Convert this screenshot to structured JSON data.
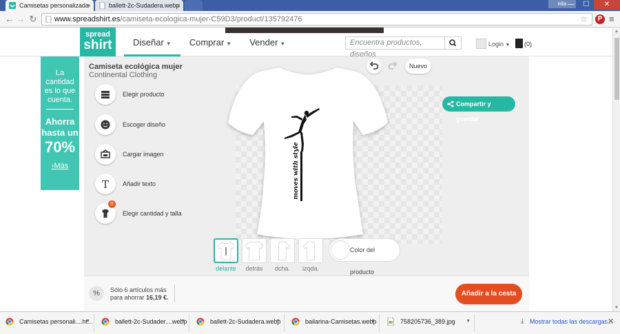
{
  "browser": {
    "tabs": [
      {
        "title": "Camisetas personalizada"
      },
      {
        "title": "ballett-2c-Sudadera.webp"
      }
    ],
    "user": "elia",
    "url_host": "www.spreadshirt.es",
    "url_path": "/camiseta-ecologica-mujer-C59D3/product/135792476",
    "window_controls": {
      "minimize": "—",
      "maximize": "☐",
      "close": "✕"
    }
  },
  "site": {
    "logo_line1": "spread",
    "logo_line2": "shirt",
    "promo_strip": "",
    "nav": [
      {
        "label": "Diseñar"
      },
      {
        "label": "Comprar"
      },
      {
        "label": "Vender"
      }
    ],
    "search_placeholder": "Encuentra productos, diseños",
    "login_label": "Login",
    "cart_count": "(0)"
  },
  "ad": {
    "text1": "La cantidad es lo que cuenta.",
    "text2": "Ahorra hasta un",
    "percent": "70%",
    "more": "Más"
  },
  "designer": {
    "product_title": "Camiseta ecológica mujer",
    "product_subtitle": "Continental Clothing",
    "tools": [
      {
        "label": "Elegir producto",
        "icon": "shirt-stack-icon"
      },
      {
        "label": "Escoger diseño",
        "icon": "smiley-icon"
      },
      {
        "label": "Cargar imagen",
        "icon": "upload-image-icon"
      },
      {
        "label": "Añadir texto",
        "icon": "text-icon"
      },
      {
        "label": "Elegir cantidad y talla",
        "icon": "size-icon",
        "badge": "0"
      }
    ],
    "new_label": "Nuevo",
    "share_label": "Compartir y guardar",
    "design_text": "moves with style",
    "views": [
      {
        "label": "delante",
        "active": true
      },
      {
        "label": "detrás",
        "active": false
      },
      {
        "label": "dcha.",
        "active": false
      },
      {
        "label": "izqda.",
        "active": false
      }
    ],
    "color_label": "Color del producto",
    "accent": "#27b8a4"
  },
  "bottom": {
    "percent_symbol": "%",
    "msg_line1": "Sólo 6 artículos más",
    "msg_line2_prefix": "para ahorrar ",
    "msg_line2_amount": "16,19 €.",
    "cta": "Añadir a la cesta",
    "cta_color": "#e44d21"
  },
  "downloads": {
    "items": [
      {
        "name": "Camisetas personali....ht..."
      },
      {
        "name": "ballett-2c-Sudader....webp"
      },
      {
        "name": "ballett-2c-Sudadera.webp"
      },
      {
        "name": "bailarina-Camisetas.webp"
      },
      {
        "name": "758205736_389.jpg"
      }
    ],
    "show_all": "Mostrar todas las descargas..."
  }
}
